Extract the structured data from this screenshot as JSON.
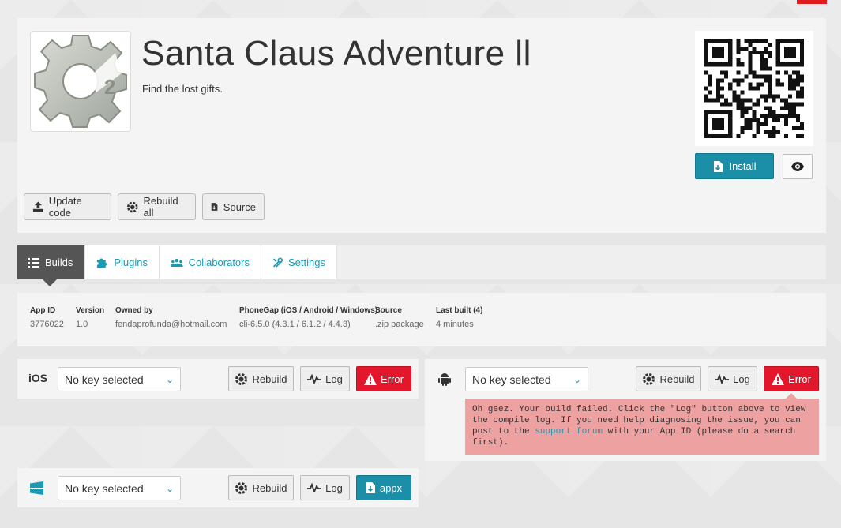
{
  "app": {
    "title": "Santa Claus Adventure ll",
    "subtitle": "Find the lost gifts.",
    "icon_name": "construct2-gear-icon"
  },
  "header_actions": {
    "install_label": "Install",
    "preview_icon": "eye-icon"
  },
  "toolbar": {
    "update_label": "Update code",
    "rebuild_all_label": "Rebuild all",
    "source_label": "Source"
  },
  "tabs": [
    {
      "label": "Builds",
      "icon": "list-icon",
      "active": true
    },
    {
      "label": "Plugins",
      "icon": "puzzle-icon",
      "active": false
    },
    {
      "label": "Collaborators",
      "icon": "users-icon",
      "active": false
    },
    {
      "label": "Settings",
      "icon": "wrench-icon",
      "active": false
    }
  ],
  "info": {
    "app_id": {
      "label": "App ID",
      "value": "3776022"
    },
    "version": {
      "label": "Version",
      "value": "1.0"
    },
    "owner": {
      "label": "Owned by",
      "value": "fendaprofunda@hotmail.com"
    },
    "phonegap": {
      "label": "PhoneGap (iOS / Android / Windows)",
      "value": "cli-6.5.0 (4.3.1 / 6.1.2 / 4.4.3)"
    },
    "source": {
      "label": "Source",
      "value": ".zip package"
    },
    "last_built": {
      "label": "Last built (4)",
      "value": "4 minutes"
    }
  },
  "platforms": {
    "ios": {
      "label": "iOS",
      "key": "No key selected",
      "rebuild": "Rebuild",
      "log": "Log",
      "status": "Error"
    },
    "android": {
      "icon": "android-icon",
      "key": "No key selected",
      "rebuild": "Rebuild",
      "log": "Log",
      "status": "Error",
      "error_text_1": "Oh geez. Your build failed. Click the \"Log\" button above to view the compile log. If you need help diagnosing the issue, you can post to the ",
      "error_link": "support forum",
      "error_text_2": " with your App ID (please do a search first)."
    },
    "windows": {
      "icon": "windows-icon",
      "key": "No key selected",
      "rebuild": "Rebuild",
      "log": "Log",
      "status": "appx"
    }
  },
  "colors": {
    "accent": "#1c8fa8",
    "error": "#e3172b",
    "error_box": "#eea1a1",
    "tab_active": "#555555"
  }
}
